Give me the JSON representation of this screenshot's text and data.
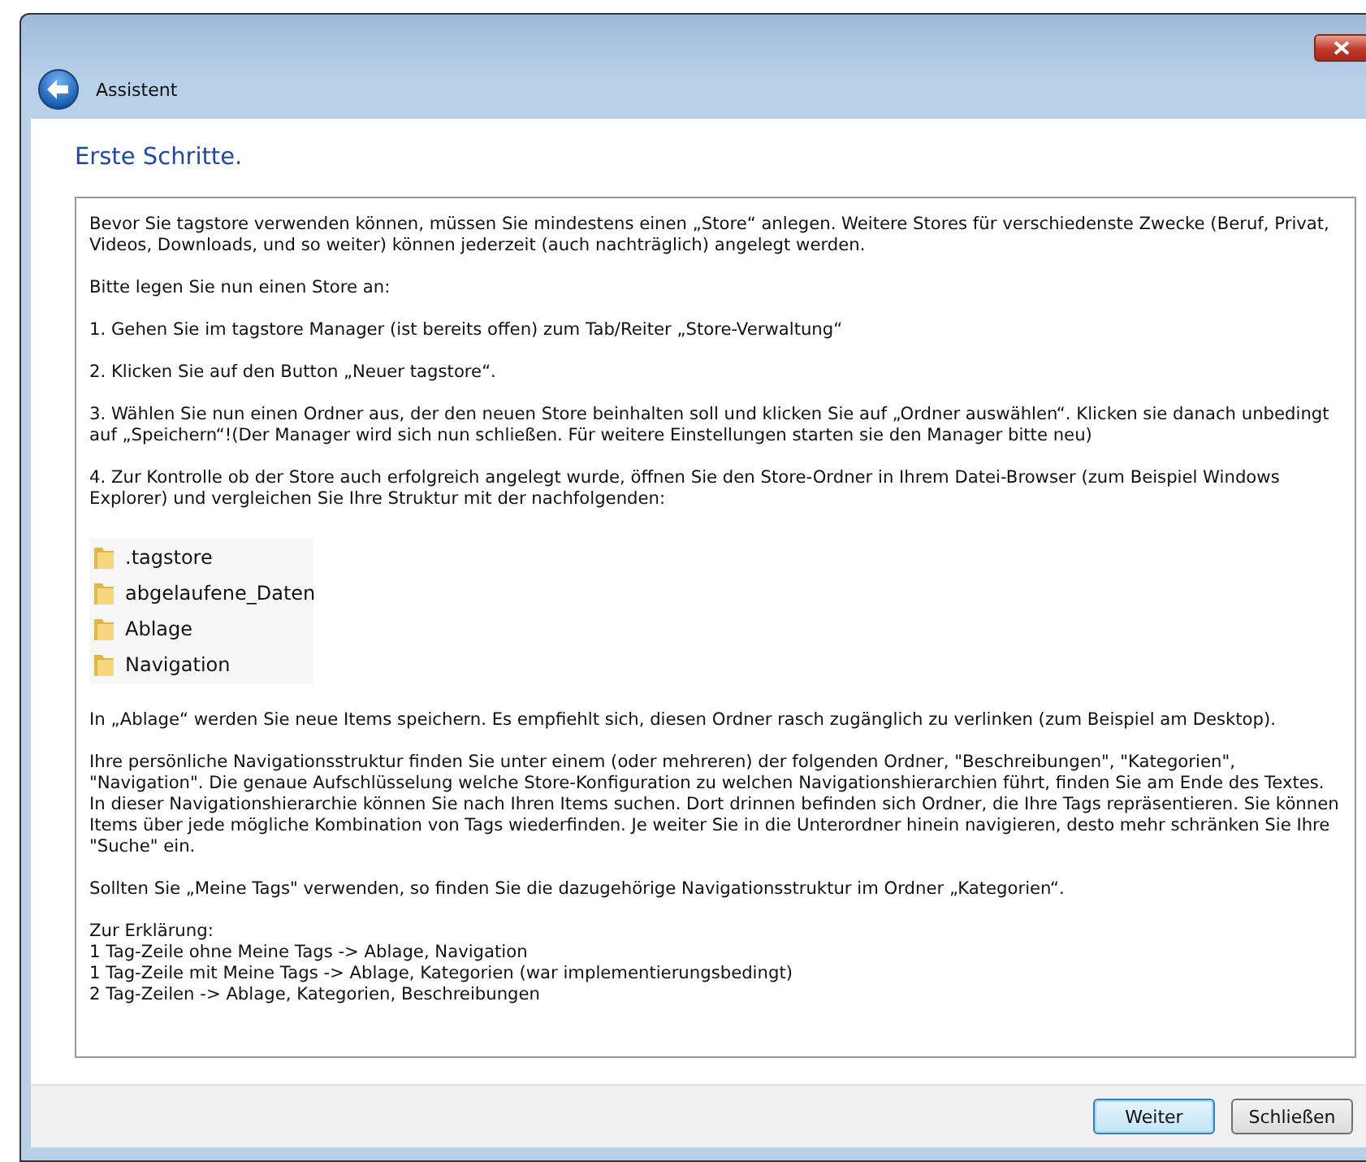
{
  "window": {
    "title": "Assistent"
  },
  "heading": "Erste Schritte.",
  "content": [
    {
      "kind": "paragraph",
      "text": "Bevor Sie tagstore verwenden können, müssen Sie mindestens einen „Store“ anlegen. Weitere Stores für verschiedenste Zwecke (Beruf, Privat, Videos, Downloads, und so weiter) können jederzeit (auch nachträglich) angelegt werden."
    },
    {
      "kind": "paragraph",
      "text": "Bitte legen Sie nun einen Store an:"
    },
    {
      "kind": "paragraph",
      "text": "1. Gehen Sie im tagstore Manager (ist bereits offen) zum Tab/Reiter „Store-Verwaltung“"
    },
    {
      "kind": "paragraph",
      "text": "2. Klicken Sie auf den Button „Neuer tagstore“."
    },
    {
      "kind": "paragraph",
      "text": "3. Wählen Sie nun einen Ordner aus, der den neuen Store beinhalten soll und klicken Sie auf „Ordner auswählen“. Klicken sie danach unbedingt auf „Speichern“!(Der Manager wird sich nun schließen. Für weitere Einstellungen starten sie den Manager bitte neu)"
    },
    {
      "kind": "paragraph",
      "text": "4. Zur Kontrolle ob der Store auch erfolgreich angelegt wurde, öffnen Sie den Store-Ordner in Ihrem Datei-Browser (zum Beispiel Windows Explorer) und vergleichen Sie Ihre Struktur mit der nachfolgenden:"
    },
    {
      "kind": "folders",
      "items": [
        ".tagstore",
        "abgelaufene_Daten",
        "Ablage",
        "Navigation"
      ]
    },
    {
      "kind": "paragraph",
      "text": "In „Ablage“ werden Sie neue Items speichern. Es empfiehlt sich, diesen Ordner rasch zugänglich zu verlinken (zum Beispiel am Desktop)."
    },
    {
      "kind": "paragraph",
      "text": "Ihre persönliche Navigationsstruktur finden Sie unter einem (oder mehreren) der folgenden Ordner, \"Beschreibungen\", \"Kategorien\", \"Navigation\". Die genaue Aufschlüsselung welche Store-Konfiguration zu welchen Navigationshierarchien führt, finden Sie am Ende des Textes. In dieser Navigationshierarchie können Sie nach Ihren Items suchen. Dort drinnen befinden sich Ordner, die Ihre Tags repräsentieren. Sie können Items über jede mögliche Kombination von Tags wiederfinden. Je weiter Sie in die Unterordner hinein navigieren, desto mehr schränken Sie Ihre \"Suche\" ein."
    },
    {
      "kind": "paragraph",
      "text": "Sollten Sie „Meine Tags\" verwenden, so finden Sie die dazugehörige Navigationsstruktur im Ordner „Kategorien“."
    },
    {
      "kind": "lines",
      "lines": [
        "Zur Erklärung:",
        "1 Tag-Zeile ohne Meine Tags -> Ablage, Navigation",
        "1 Tag-Zeile mit Meine Tags -> Ablage, Kategorien (war implementierungsbedingt)",
        "2 Tag-Zeilen -> Ablage, Kategorien, Beschreibungen"
      ]
    }
  ],
  "buttons": [
    {
      "label": "Weiter",
      "default": true
    },
    {
      "label": "Schließen",
      "default": false
    }
  ]
}
